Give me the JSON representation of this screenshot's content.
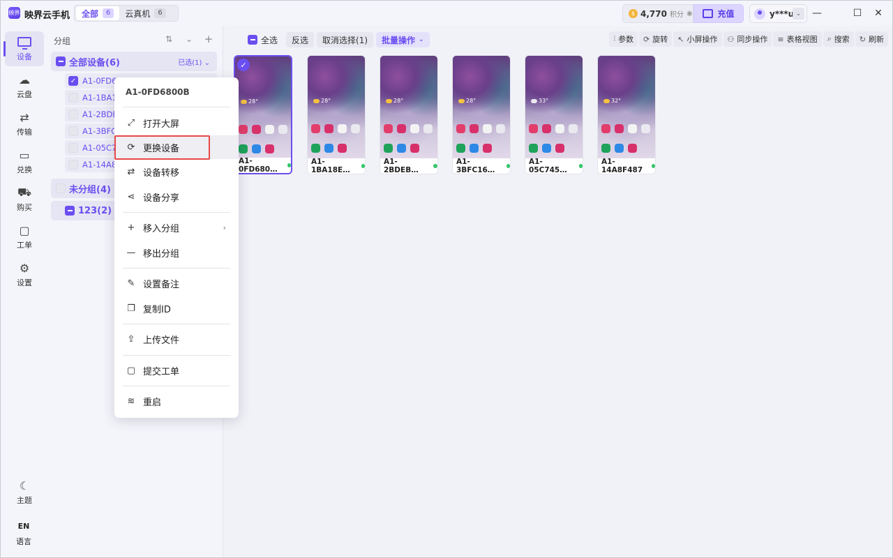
{
  "app": {
    "name": "映界云手机",
    "logo_text": "映界"
  },
  "top_tabs": [
    {
      "label": "全部",
      "count": "6"
    },
    {
      "label": "云真机",
      "count": "6"
    }
  ],
  "header": {
    "points_value": "4,770",
    "points_unit": "积分",
    "recharge_label": "充值",
    "user_name": "y***u"
  },
  "rail": {
    "items": [
      {
        "label": "设备"
      },
      {
        "label": "云盘"
      },
      {
        "label": "传输"
      },
      {
        "label": "兑换"
      },
      {
        "label": "购买"
      },
      {
        "label": "工单"
      },
      {
        "label": "设置"
      }
    ],
    "theme_label": "主题",
    "lang_code": "EN",
    "lang_label": "语言"
  },
  "groups": {
    "title": "分组",
    "all": {
      "name": "全部设备(6)",
      "selected": "已选(1)"
    },
    "devices": [
      "A1-0FD68",
      "A1-1BA1",
      "A1-2BDE",
      "A1-3BFC",
      "A1-05C74",
      "A1-14A8"
    ],
    "ungrouped": "未分组(4)",
    "custom": "123(2)"
  },
  "toolbar": {
    "select_all": "全选",
    "invert": "反选",
    "deselect": "取消选择(1)",
    "batch": "批量操作",
    "params": "参数",
    "rotate": "旋转",
    "small_screen": "小屏操作",
    "sync": "同步操作",
    "table_view": "表格视图",
    "search": "搜索",
    "refresh": "刷新"
  },
  "cards": [
    {
      "label": "A1-0FD680…",
      "temp": "28°"
    },
    {
      "label": "A1-1BA18E…",
      "temp": "28°"
    },
    {
      "label": "A1-2BDEB…",
      "temp": "28°"
    },
    {
      "label": "A1-3BFC16…",
      "temp": "28°"
    },
    {
      "label": "A1-05C745…",
      "temp": "33°"
    },
    {
      "label": "A1-14A8F487",
      "temp": "32°"
    }
  ],
  "context_menu": {
    "header": "A1-0FD6800B",
    "items": [
      "打开大屏",
      "更换设备",
      "设备转移",
      "设备分享",
      "移入分组",
      "移出分组",
      "设置备注",
      "复制ID",
      "上传文件",
      "提交工单",
      "重启"
    ]
  }
}
